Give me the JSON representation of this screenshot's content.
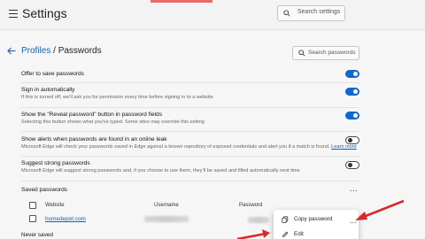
{
  "header": {
    "title": "Settings",
    "search_placeholder": "Search settings"
  },
  "breadcrumb": {
    "parent": "Profiles",
    "separator": " / ",
    "current": "Passwords"
  },
  "password_search": {
    "placeholder": "Search passwords"
  },
  "settings": [
    {
      "label": "Offer to save passwords",
      "description": "",
      "toggle": "on"
    },
    {
      "label": "Sign in automatically",
      "description": "If this is turned off, we'll ask you for permission every time before signing in to a website",
      "toggle": "on"
    },
    {
      "label": "Show the \"Reveal password\" button in password fields",
      "description": "Selecting this button shows what you've typed. Some sites may override this setting",
      "toggle": "on"
    },
    {
      "label": "Show alerts when passwords are found in an online leak",
      "description": "Microsoft Edge will check your passwords saved in Edge against a known repository of exposed credentials and alert you if a match is found.",
      "link": "Learn more",
      "toggle": "off"
    },
    {
      "label": "Suggest strong passwords",
      "description": "Microsoft Edge will suggest strong passwords and, if you choose to use them, they'll be saved and filled automatically next time",
      "toggle": "off"
    }
  ],
  "saved_passwords": {
    "title": "Saved passwords",
    "more": "...",
    "columns": [
      "Website",
      "Username",
      "Password"
    ],
    "rows": [
      {
        "website": "homedepot.com"
      }
    ]
  },
  "context_menu": {
    "items": [
      {
        "label": "Copy password",
        "icon": "copy-icon"
      },
      {
        "label": "Edit",
        "icon": "pencil-icon"
      }
    ]
  },
  "never_saved": {
    "title": "Never saved"
  },
  "colors": {
    "accent": "#1267c8",
    "link": "#1a5fa8",
    "annotation_arrow": "#d42b2b"
  }
}
